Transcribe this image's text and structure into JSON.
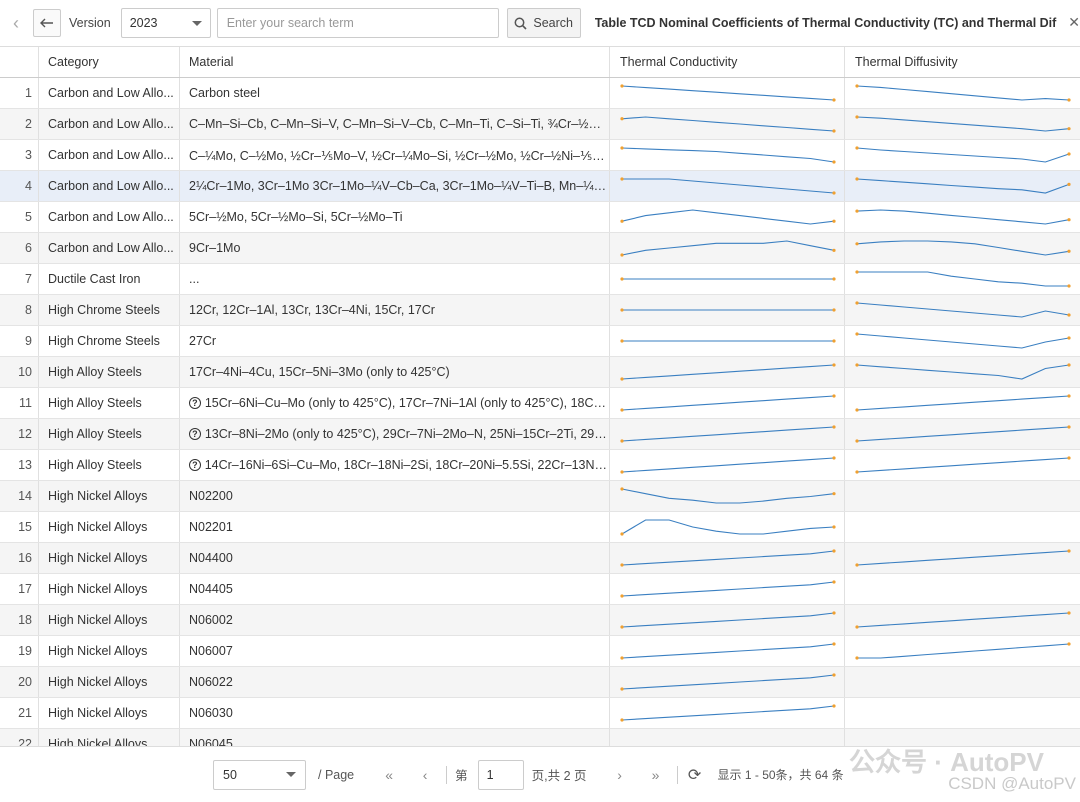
{
  "toolbar": {
    "back_icon": "chevron-left-icon",
    "arrow_icon": "arrow-left-icon",
    "version_label": "Version",
    "version_value": "2023",
    "search_placeholder": "Enter your search term",
    "search_value": "",
    "search_label": "Search",
    "title": "Table TCD Nominal Coefficients of Thermal Conductivity (TC) and Thermal Dif",
    "close_icon": "close-icon"
  },
  "table": {
    "headers": [
      "Category",
      "Material",
      "Thermal Conductivity",
      "Thermal Diffusivity"
    ],
    "rows": [
      {
        "n": "1",
        "category": "Carbon and Low Allo...",
        "material": "Carbon steel",
        "help": false,
        "tc": [
          0,
          -1,
          -2,
          -3,
          -4,
          -5,
          -6,
          -7,
          -8,
          -9
        ],
        "td": [
          0,
          -1,
          -2.5,
          -4,
          -5.5,
          -7,
          -8.5,
          -10,
          -9,
          -10
        ]
      },
      {
        "n": "2",
        "category": "Carbon and Low Allo...",
        "material": "C–Mn–Si–Cb, C–Mn–Si–V, C–Mn–Si–V–Cb, C–Mn–Ti, C–Si–Ti, ¾Cr–½Ni–Cu, ...",
        "help": false,
        "tc": [
          -1,
          0,
          -1,
          -2,
          -3,
          -4,
          -5,
          -6,
          -7,
          -8
        ],
        "td": [
          0,
          -1,
          -2.5,
          -4,
          -5.5,
          -7,
          -8.5,
          -10,
          -12,
          -10
        ]
      },
      {
        "n": "3",
        "category": "Carbon and Low Allo...",
        "material": "C–¼Mo, C–½Mo, ½Cr–⅕Mo–V, ½Cr–¼Mo–Si, ½Cr–½Mo, ½Cr–½Ni–⅕Mo, ¾...",
        "help": false,
        "tc": [
          0,
          -0.5,
          -1,
          -1.5,
          -2,
          -3,
          -4,
          -5,
          -6,
          -8
        ],
        "td": [
          0,
          -2,
          -3.5,
          -5,
          -6.5,
          -8,
          -9.5,
          -11,
          -14,
          -6
        ]
      },
      {
        "n": "4",
        "category": "Carbon and Low Allo...",
        "material": "2¼Cr–1Mo, 3Cr–1Mo 3Cr–1Mo–¼V–Cb–Ca, 3Cr–1Mo–¼V–Ti–B, Mn–¼Mo, ...",
        "help": false,
        "tc": [
          0,
          0,
          0,
          -0.5,
          -1,
          -1.5,
          -2,
          -2.5,
          -3,
          -3.5
        ],
        "td": [
          0,
          -1.5,
          -3,
          -4.5,
          -6,
          -7.5,
          -9,
          -10,
          -13,
          -5
        ]
      },
      {
        "n": "5",
        "category": "Carbon and Low Allo...",
        "material": "5Cr–½Mo, 5Cr–½Mo–Si, 5Cr–½Mo–Ti",
        "help": false,
        "tc": [
          -1,
          0,
          0.5,
          1,
          0.5,
          0,
          -0.5,
          -1,
          -1.5,
          -1
        ],
        "td": [
          0,
          0.5,
          0,
          -1,
          -2,
          -3,
          -4,
          -5,
          -6,
          -4
        ]
      },
      {
        "n": "6",
        "category": "Carbon and Low Allo...",
        "material": "9Cr–1Mo",
        "help": false,
        "tc": [
          -1,
          0,
          0.5,
          1,
          1.5,
          1.5,
          1.5,
          2,
          1,
          0
        ],
        "td": [
          0,
          1,
          1.5,
          1.5,
          1,
          0,
          -2,
          -4,
          -6,
          -4
        ]
      },
      {
        "n": "7",
        "category": "Ductile Cast Iron",
        "material": "...",
        "help": false,
        "tc": [
          0,
          0,
          0,
          0,
          0,
          0,
          0,
          0,
          0,
          0
        ],
        "td": [
          0,
          0,
          0,
          0,
          -0.3,
          -0.5,
          -0.7,
          -0.8,
          -1,
          -1
        ]
      },
      {
        "n": "8",
        "category": "High Chrome Steels",
        "material": "12Cr, 12Cr–1Al, 13Cr, 13Cr–4Ni, 15Cr, 17Cr",
        "help": false,
        "tc": [
          0,
          0,
          0,
          0,
          0,
          0,
          0,
          0,
          0,
          0
        ],
        "td": [
          0,
          -1,
          -2,
          -3,
          -4,
          -5,
          -6,
          -7,
          -4,
          -6
        ]
      },
      {
        "n": "9",
        "category": "High Chrome Steels",
        "material": "27Cr",
        "help": false,
        "tc": [
          0,
          0,
          0,
          0,
          0,
          0,
          0,
          0,
          0,
          0
        ],
        "td": [
          0,
          -0.5,
          -1,
          -1.5,
          -2,
          -2.5,
          -3,
          -3.5,
          -2,
          -1
        ]
      },
      {
        "n": "10",
        "category": "High Alloy Steels",
        "material": "17Cr–4Ni–4Cu, 15Cr–5Ni–3Mo (only to 425°C)",
        "help": false,
        "tc": [
          -2,
          -1.5,
          -1,
          -0.5,
          0,
          0.5,
          1,
          1.5,
          2,
          2.5
        ],
        "td": [
          0,
          -0.5,
          -1,
          -1.5,
          -2,
          -2.5,
          -3,
          -4,
          -1,
          0
        ]
      },
      {
        "n": "11",
        "category": "High Alloy Steels",
        "material": "15Cr–6Ni–Cu–Mo (only to 425°C), 17Cr–7Ni–1Al (only to 425°C), 18Cr–...",
        "help": true,
        "tc": [
          -2,
          -1.5,
          -1,
          -0.5,
          0,
          0.5,
          1,
          1.5,
          2,
          2.5
        ],
        "td": [
          -2,
          -1.5,
          -1,
          -0.5,
          0,
          0.5,
          1,
          1.5,
          2,
          2.5
        ]
      },
      {
        "n": "12",
        "category": "High Alloy Steels",
        "material": "13Cr–8Ni–2Mo (only to 425°C), 29Cr–7Ni–2Mo–N, 25Ni–15Cr–2Ti, 29Ni...",
        "help": true,
        "tc": [
          -2,
          -1.5,
          -1,
          -0.5,
          0,
          0.5,
          1,
          1.5,
          2,
          2.5
        ],
        "td": [
          -2,
          -1.5,
          -1,
          -0.5,
          0,
          0.5,
          1,
          1.5,
          2,
          2.5
        ]
      },
      {
        "n": "13",
        "category": "High Alloy Steels",
        "material": "14Cr–16Ni–6Si–Cu–Mo, 18Cr–18Ni–2Si, 18Cr–20Ni–5.5Si, 22Cr–13Ni–5...",
        "help": true,
        "tc": [
          -3,
          -2.5,
          -2,
          -1.5,
          -1,
          -0.5,
          0,
          0.5,
          1,
          1.5
        ],
        "td": [
          -3,
          -2.5,
          -2,
          -1.5,
          -1,
          -0.5,
          0,
          0.5,
          1,
          1.5
        ]
      },
      {
        "n": "14",
        "category": "High Nickel Alloys",
        "material": "N02200",
        "help": false,
        "tc": [
          0,
          -0.5,
          -1,
          -1.2,
          -1.5,
          -1.5,
          -1.3,
          -1,
          -0.8,
          -0.5
        ],
        "td": null
      },
      {
        "n": "15",
        "category": "High Nickel Alloys",
        "material": "N02201",
        "help": false,
        "tc": [
          -1,
          0,
          0,
          -0.5,
          -0.8,
          -1,
          -1,
          -0.8,
          -0.6,
          -0.5
        ],
        "td": null
      },
      {
        "n": "16",
        "category": "High Nickel Alloys",
        "material": "N04400",
        "help": false,
        "tc": [
          -3,
          -2.5,
          -2,
          -1.5,
          -1,
          -0.5,
          0,
          0.5,
          1,
          2
        ],
        "td": [
          -2,
          -1.7,
          -1.4,
          -1.1,
          -0.8,
          -0.5,
          -0.2,
          0.1,
          0.4,
          0.7
        ]
      },
      {
        "n": "17",
        "category": "High Nickel Alloys",
        "material": "N04405",
        "help": false,
        "tc": [
          -3,
          -2.5,
          -2,
          -1.5,
          -1,
          -0.5,
          0,
          0.5,
          1,
          2
        ],
        "td": null
      },
      {
        "n": "18",
        "category": "High Nickel Alloys",
        "material": "N06002",
        "help": false,
        "tc": [
          -4,
          -3.5,
          -3,
          -2.5,
          -2,
          -1.5,
          -1,
          -0.5,
          0,
          1
        ],
        "td": [
          -3,
          -2.5,
          -2,
          -1.5,
          -1,
          -0.5,
          0,
          0.5,
          1,
          1.5
        ]
      },
      {
        "n": "19",
        "category": "High Nickel Alloys",
        "material": "N06007",
        "help": false,
        "tc": [
          -3,
          -2.5,
          -2,
          -1.5,
          -1,
          -0.5,
          0,
          0.5,
          1,
          2
        ],
        "td": [
          -2,
          -2,
          -1.5,
          -1,
          -0.5,
          0,
          0.5,
          1,
          1.5,
          2
        ]
      },
      {
        "n": "20",
        "category": "High Nickel Alloys",
        "material": "N06022",
        "help": false,
        "tc": [
          -4,
          -3.5,
          -3,
          -2.5,
          -2,
          -1.5,
          -1,
          -0.5,
          0,
          1
        ],
        "td": null
      },
      {
        "n": "21",
        "category": "High Nickel Alloys",
        "material": "N06030",
        "help": false,
        "tc": [
          -5,
          -4.5,
          -4,
          -3.5,
          -3,
          -2.5,
          -2,
          -1.5,
          -1,
          0
        ],
        "td": null
      },
      {
        "n": "22",
        "category": "High Nickel Alloys",
        "material": "N06045",
        "help": false,
        "tc": null,
        "td": null
      }
    ]
  },
  "footer": {
    "page_size": "50",
    "per_page": "/ Page",
    "page_prefix": "第",
    "page_value": "1",
    "page_suffix": "页,共 2 页",
    "summary": "显示 1 - 50条，共 64 条",
    "watermark_wechat": "公众号 · AutoPV",
    "watermark_csdn": "CSDN @AutoPV"
  },
  "colors": {
    "spark_line": "#3a7fc1",
    "spark_dot": "#f0a030",
    "selected_row": "#e8eef8",
    "alt_row": "#f5f5f5"
  }
}
